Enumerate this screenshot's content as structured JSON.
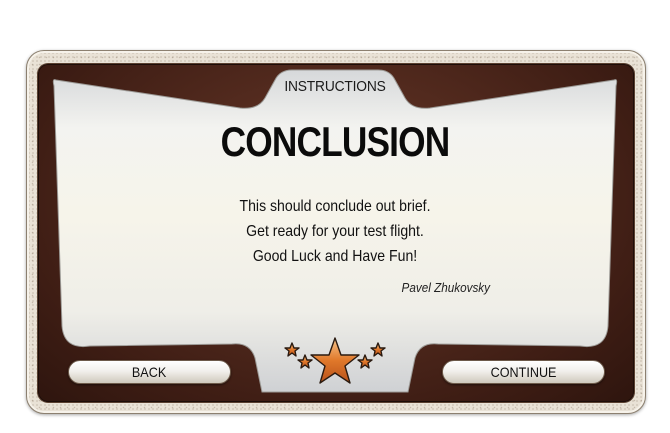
{
  "panel": {
    "header": "INSTRUCTIONS",
    "title": "CONCLUSION",
    "message_lines": [
      "This should conclude out brief.",
      "Get ready for your test flight.",
      "Good Luck and Have Fun!"
    ],
    "signature": "Pavel Zhukovsky"
  },
  "buttons": {
    "back_label": "BACK",
    "continue_label": "CONTINUE"
  },
  "decoration": {
    "stars": [
      "star-icon",
      "star-icon",
      "star-icon",
      "star-icon",
      "star-icon"
    ],
    "colors": {
      "frame_brown": "#4a2418",
      "star_fill": "#e07a2a",
      "star_outline": "#2a1a10",
      "panel_light": "#f4f2ec"
    }
  }
}
